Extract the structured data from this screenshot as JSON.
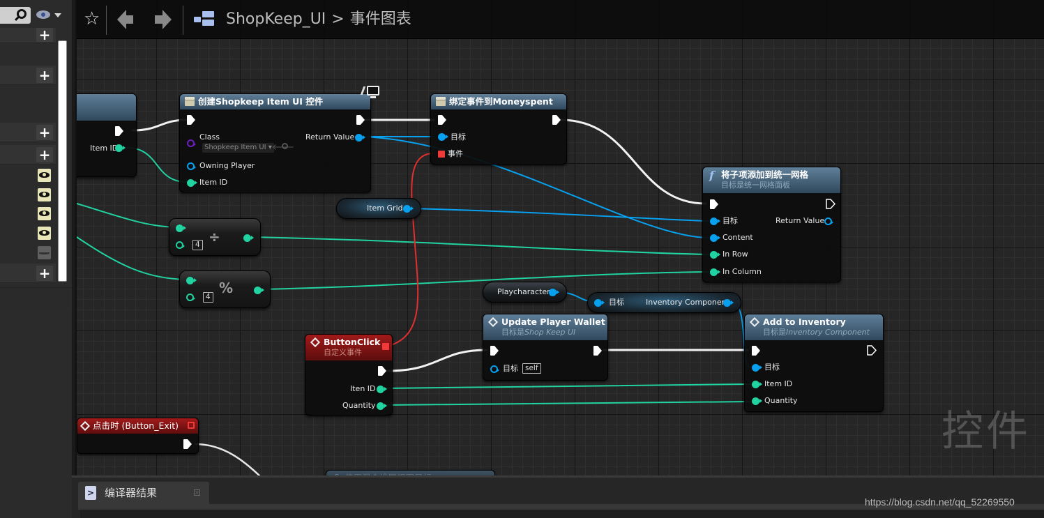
{
  "left_panel": {
    "visible_toggle_states": [
      "on",
      "on",
      "on",
      "on",
      "off"
    ]
  },
  "toolbar": {
    "breadcrumb_root": "ShopKeep_UI",
    "breadcrumb_separator": ">",
    "breadcrumb_current": "事件图表"
  },
  "nodes": {
    "partial_left": {
      "pin_item_id": "Item ID"
    },
    "create_widget": {
      "title": "创建Shopkeep Item UI 控件",
      "class_label": "Class",
      "class_value": "Shopkeep Item UI",
      "owning_player": "Owning Player",
      "item_id": "Item ID",
      "return_value": "Return Value"
    },
    "bind_event": {
      "title": "绑定事件到Moneyspent",
      "target": "目标",
      "event": "事件"
    },
    "add_child": {
      "title": "将子项添加到统一网格",
      "subtitle": "目标是统一网格面板",
      "target": "目标",
      "content": "Content",
      "in_row": "In Row",
      "in_column": "In Column",
      "return_value": "Return Value"
    },
    "item_grid": {
      "label": "Item Grid"
    },
    "divide": {
      "operator": "÷",
      "literal": "4"
    },
    "modulo": {
      "operator": "%",
      "literal": "4"
    },
    "playcharacter": {
      "label": "Playcharacter"
    },
    "inventory_getter": {
      "target": "目标",
      "output": "Inventory Component"
    },
    "update_wallet": {
      "title": "Update Player Wallet",
      "subtitle_prefix": "目标是",
      "subtitle_class": "Shop Keep UI",
      "target": "目标",
      "target_literal": "self"
    },
    "add_inventory": {
      "title": "Add to Inventory",
      "subtitle_prefix": "目标是",
      "subtitle_class": "Inventory Component",
      "target": "目标",
      "item_id": "Item ID",
      "quantity": "Quantity"
    },
    "button_click": {
      "title": "ButtonClick",
      "subtitle": "自定义事件",
      "item_id": "Iten ID",
      "quantity": "Quantity"
    },
    "on_clicked_exit": {
      "title": "点击时 (Button_Exit)"
    },
    "partial_bottom": {
      "title": "使用混合设置视图目标"
    }
  },
  "watermark": "控件",
  "bottom_panel": {
    "tab_label": "编译器结果"
  },
  "csdn_watermark": "https://blog.csdn.net/qq_52269550",
  "colors": {
    "exec": "#ffffff",
    "integer": "#20d3a1",
    "object": "#07a1f0",
    "delegate": "#f03a3a",
    "class": "#6a1fbf"
  }
}
